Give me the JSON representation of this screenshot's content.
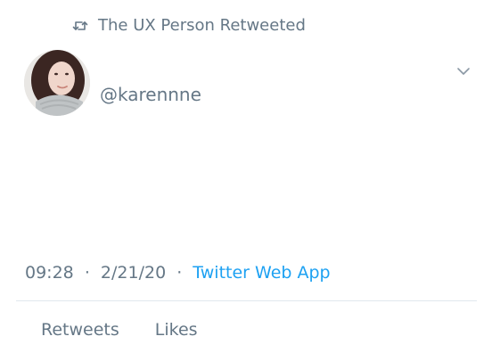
{
  "retweet_context": {
    "icon": "retweet-icon",
    "text": "The UX Person Retweeted"
  },
  "tweet": {
    "avatar_icon": "user-avatar",
    "handle": "@karennne",
    "timestamp": {
      "time": "09:28",
      "date": "2/21/20",
      "separator": "·",
      "source": "Twitter Web App"
    },
    "stats": {
      "retweets_label": "Retweets",
      "likes_label": "Likes"
    }
  },
  "colors": {
    "secondary_text": "#657786",
    "link": "#1da1f2",
    "divider": "#e1e8ed"
  }
}
